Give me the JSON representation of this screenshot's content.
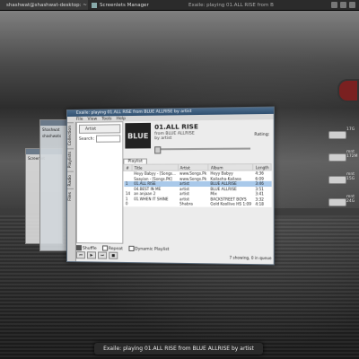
{
  "taskbar": {
    "tasks": [
      {
        "label": "shashwat@shashwat-desktop: ~"
      },
      {
        "label": "Screenlets Manager"
      },
      {
        "label": "Exaile: playing 01.ALL RISE from B"
      }
    ]
  },
  "ghost_windows": {
    "back_title": "Screenlet",
    "mid_title": "Ghost",
    "mid_line1": "Shashwat",
    "mid_line2": "shashwats"
  },
  "drives": [
    {
      "label": "17G"
    },
    {
      "label": "mnt 172M"
    },
    {
      "label": "mnt 15G"
    },
    {
      "label": "mnt 24G"
    }
  ],
  "exaile": {
    "title": "Exaile: playing 01.ALL RISE from BLUE ALLRISE by artist",
    "menu": [
      "File",
      "View",
      "Tools",
      "Help"
    ],
    "side_tabs": [
      "Collection",
      "Playlists",
      "Radio",
      "Files"
    ],
    "browser": {
      "selector": "Artist",
      "search_label": "Search:"
    },
    "now_playing": {
      "cover_text": "BLUE",
      "track": "01.ALL RISE",
      "from": "from BLUE ALLRISE",
      "by": "by artist",
      "rating_label": "Rating:"
    },
    "playlist_tab": "Playlist",
    "columns": [
      "#",
      "Title",
      "Artist",
      "Album",
      "Length"
    ],
    "rows": [
      {
        "num": "",
        "title": "Heyy Babyy - [Songs...",
        "artist": "www.Songs.Pk",
        "album": "Heyy Babyy",
        "length": "4:36",
        "selected": false
      },
      {
        "num": "",
        "title": "Saayian - [Songs.PK]",
        "artist": "www.Songs.Pk",
        "album": "Kailasha-Kailasa",
        "length": "6:09",
        "selected": false
      },
      {
        "num": "1",
        "title": "01.ALL RISE",
        "artist": "artist",
        "album": "BLUE ALLRISE",
        "length": "3:46",
        "selected": true
      },
      {
        "num": "",
        "title": "04.BEST IN ME",
        "artist": "artist",
        "album": "BLUE ALLRISE",
        "length": "3:51",
        "selected": false
      },
      {
        "num": "14",
        "title": "an anjaan 2",
        "artist": "artist",
        "album": "Mix",
        "length": "3:41",
        "selected": false
      },
      {
        "num": "1",
        "title": "01.WHEN IT SHINE",
        "artist": "artist",
        "album": "BACKSTREET BOYS",
        "length": "3:32",
        "selected": false
      },
      {
        "num": "0",
        "title": "",
        "artist": "Shabra",
        "album": "Gold Koollive HS 1:09",
        "length": "4:18",
        "selected": false
      }
    ],
    "footer": {
      "shuffle": "Shuffle",
      "repeat": "Repeat",
      "dynamic": "Dynamic Playlist",
      "counter": "7 showing, 0 in queue"
    }
  },
  "osd": {
    "text": "Exaile: playing 01.ALL RISE from BLUE ALLRISE by artist"
  }
}
